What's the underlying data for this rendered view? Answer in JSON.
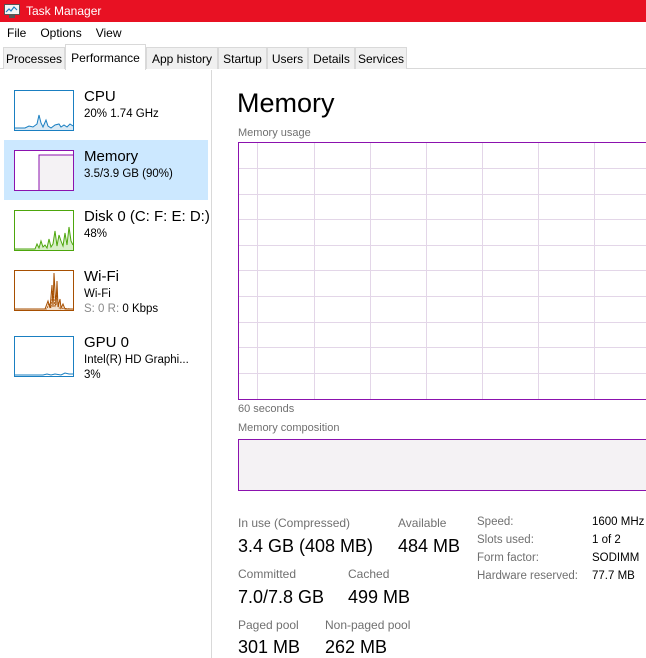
{
  "window": {
    "title": "Task Manager"
  },
  "menu": [
    "File",
    "Options",
    "View"
  ],
  "tabs": [
    "Processes",
    "Performance",
    "App history",
    "Startup",
    "Users",
    "Details",
    "Services"
  ],
  "sidebar": {
    "items": [
      {
        "title": "CPU",
        "sub1": "20% 1.74 GHz",
        "color": "#1a7fc1"
      },
      {
        "title": "Memory",
        "sub1": "3.5/3.9 GB (90%)",
        "color": "#8b12ae"
      },
      {
        "title": "Disk 0 (C: F: E: D:)",
        "sub1": "48%",
        "color": "#4da60c"
      },
      {
        "title": "Wi-Fi",
        "sub1": "Wi-Fi",
        "sub2_prefix": "S: 0 R:",
        "sub2_value": "0 Kbps",
        "color": "#a74f01"
      },
      {
        "title": "GPU 0",
        "sub1": "Intel(R) HD Graphi...",
        "sub2": "3%",
        "color": "#1a7fc1"
      }
    ]
  },
  "main": {
    "title": "Memory",
    "usage_label": "Memory usage",
    "time_label": "60 seconds",
    "composition_label": "Memory composition",
    "graph_color": "#8b12ae",
    "stats": {
      "in_use_label": "In use (Compressed)",
      "in_use_value": "3.4 GB (408 MB)",
      "available_label": "Available",
      "available_value": "484 MB",
      "committed_label": "Committed",
      "committed_value": "7.0/7.8 GB",
      "cached_label": "Cached",
      "cached_value": "499 MB",
      "paged_label": "Paged pool",
      "paged_value": "301 MB",
      "nonpaged_label": "Non-paged pool",
      "nonpaged_value": "262 MB"
    },
    "specs": [
      {
        "key": "Speed:",
        "value": "1600 MHz"
      },
      {
        "key": "Slots used:",
        "value": "1 of 2"
      },
      {
        "key": "Form factor:",
        "value": "SODIMM"
      },
      {
        "key": "Hardware reserved:",
        "value": "77.7 MB"
      }
    ]
  }
}
